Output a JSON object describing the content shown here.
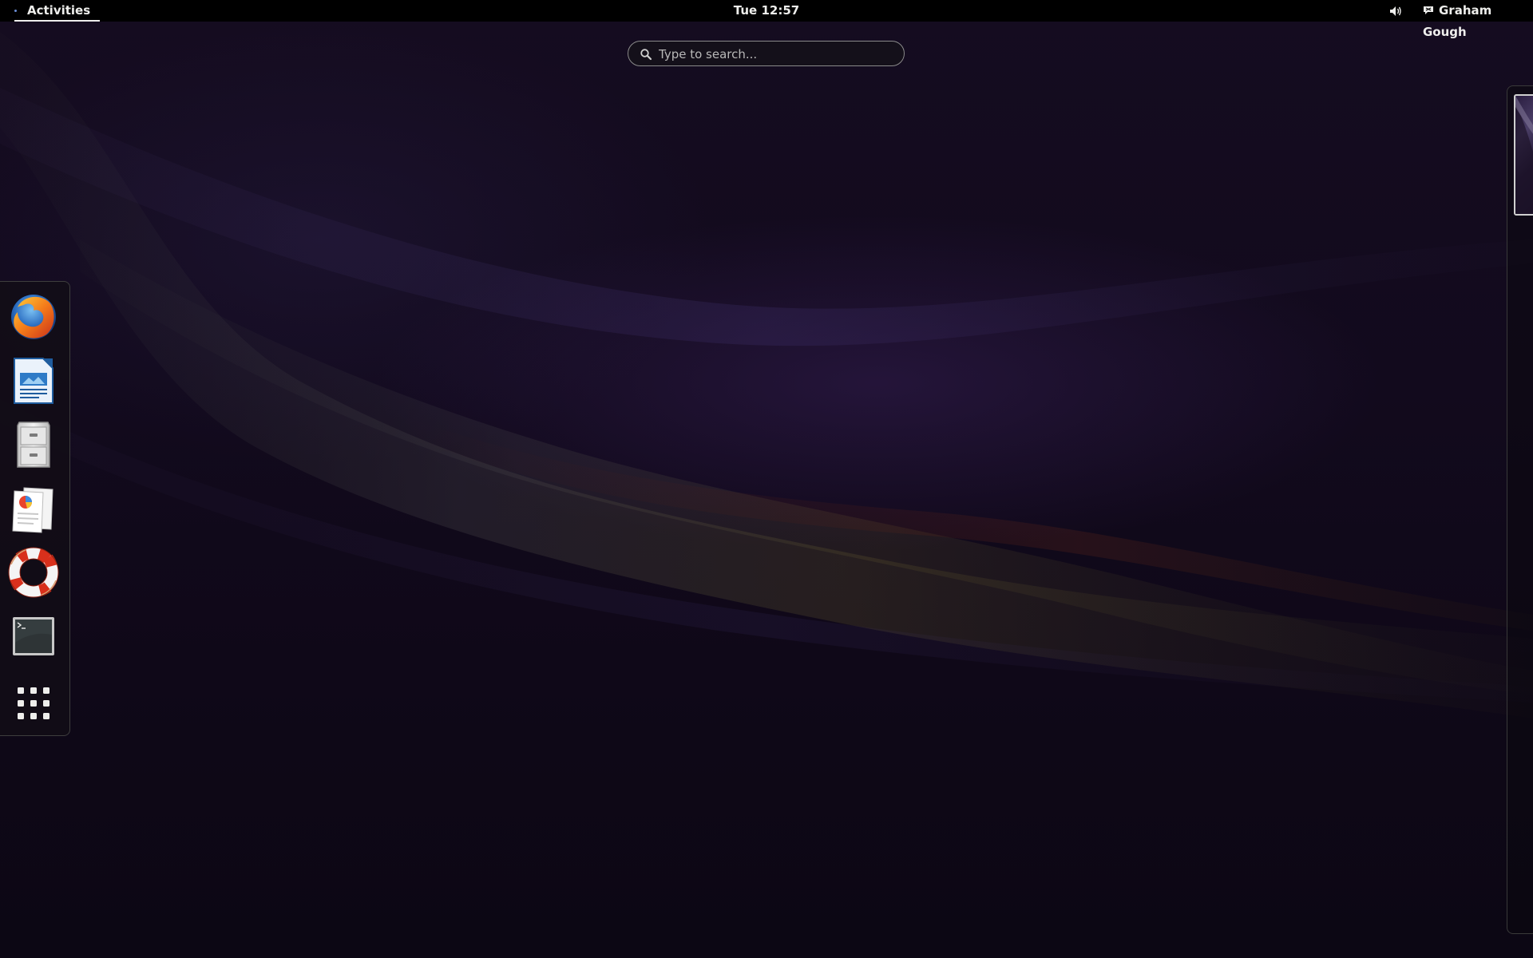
{
  "topbar": {
    "activities_label": "Activities",
    "clock": "Tue 12:57",
    "user_name": "Graham Gough",
    "volume_icon": "speaker-volume-icon",
    "user_status_icon": "chat-status-icon"
  },
  "search": {
    "placeholder": "Type to search..."
  },
  "dash": {
    "items": [
      {
        "app": "Firefox",
        "icon": "firefox-icon"
      },
      {
        "app": "LibreOffice Writer",
        "icon": "libreoffice-writer-icon"
      },
      {
        "app": "Files",
        "icon": "file-cabinet-icon"
      },
      {
        "app": "Document Viewer",
        "icon": "documents-icon"
      },
      {
        "app": "Help",
        "icon": "lifebuoy-icon"
      },
      {
        "app": "Terminal",
        "icon": "terminal-icon"
      },
      {
        "app": "Show Applications",
        "icon": "app-grid-icon"
      }
    ]
  },
  "workspaces": {
    "count": 1,
    "active": 1
  },
  "colors": {
    "topbar_bg": "#000000",
    "text": "#eeeeec",
    "wallpaper_base": "#120a1d",
    "activities_indicator": "#6b8fd6"
  }
}
